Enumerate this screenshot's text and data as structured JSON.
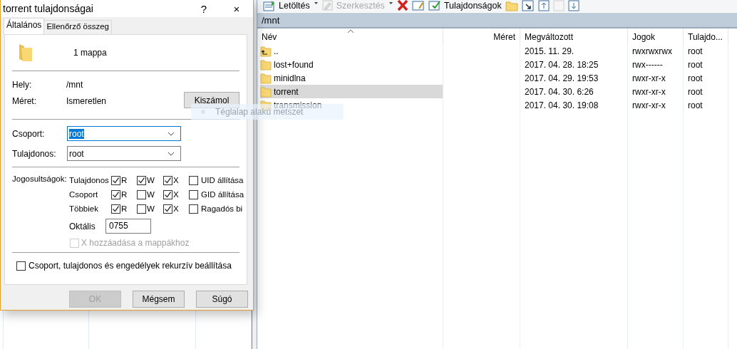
{
  "dialog": {
    "title": "torrent tulajdonságai",
    "help": "?",
    "close": "×",
    "tabs": [
      {
        "label": "Általános",
        "selected": true
      },
      {
        "label": "Ellenőrző összeg",
        "selected": false
      }
    ],
    "summary": "1 mappa",
    "fields": [
      {
        "label": "Hely:",
        "value": "/mnt"
      },
      {
        "label": "Méret:",
        "value": "Ismeretlen"
      }
    ],
    "calc_button": "Kiszámol",
    "group": {
      "label": "Csoport:",
      "value": "root",
      "focused": true
    },
    "owner": {
      "label": "Tulajdonos:",
      "value": "root",
      "focused": false
    },
    "permissions": {
      "label": "Jogosultságok:",
      "rows": [
        {
          "label": "Tulajdonos",
          "checks": [
            {
              "label": "R",
              "checked": true
            },
            {
              "label": "W",
              "checked": true
            },
            {
              "label": "X",
              "checked": true
            }
          ],
          "special": {
            "label": "UID állítása",
            "checked": false
          }
        },
        {
          "label": "Csoport",
          "checks": [
            {
              "label": "R",
              "checked": true
            },
            {
              "label": "W",
              "checked": false
            },
            {
              "label": "X",
              "checked": true
            }
          ],
          "special": {
            "label": "GID állítása",
            "checked": false
          }
        },
        {
          "label": "Többiek",
          "checks": [
            {
              "label": "R",
              "checked": true
            },
            {
              "label": "W",
              "checked": false
            },
            {
              "label": "X",
              "checked": true
            }
          ],
          "special": {
            "label": "Ragadós bi",
            "checked": false
          }
        }
      ]
    },
    "octal": {
      "label": "Oktális",
      "value": "0755"
    },
    "add_x": {
      "label": "X hozzáadása a mappákhoz",
      "checked": false,
      "disabled": true
    },
    "recursive": {
      "label": "Csoport, tulajdonos és engedélyek rekurzív beállítása",
      "checked": false
    },
    "buttons": [
      {
        "label": "OK",
        "disabled": true
      },
      {
        "label": "Mégsem",
        "disabled": false
      },
      {
        "label": "Súgó",
        "disabled": false
      }
    ]
  },
  "toolbar": [
    {
      "kind": "download",
      "label": "Letöltés",
      "disabled": false
    },
    {
      "kind": "caret"
    },
    {
      "kind": "edit",
      "label": "Szerkesztés",
      "disabled": true
    },
    {
      "kind": "caret"
    },
    {
      "kind": "delete"
    },
    {
      "kind": "rename"
    },
    {
      "kind": "properties",
      "label": "Tulajdonságok",
      "disabled": false
    },
    {
      "kind": "folder"
    },
    {
      "kind": "window"
    },
    {
      "kind": "up"
    },
    {
      "kind": "blank"
    },
    {
      "kind": "down"
    }
  ],
  "path": "/mnt",
  "file_list": {
    "columns": [
      {
        "label": "Név"
      },
      {
        "label": "Méret"
      },
      {
        "label": "Megváltozott"
      },
      {
        "label": "Jogok"
      },
      {
        "label": "Tulajdo..."
      }
    ],
    "rows": [
      {
        "kind": "up",
        "name": "..",
        "modified": "2015. 11. 29.",
        "rights": "rwxrwxrwx",
        "owner": "root",
        "selected": false
      },
      {
        "kind": "folder",
        "name": "lost+found",
        "modified": "2017. 04. 28. 18:25",
        "rights": "rwx------",
        "owner": "root",
        "selected": false
      },
      {
        "kind": "folder",
        "name": "minidlna",
        "modified": "2017. 04. 29. 19:53",
        "rights": "rwxr-xr-x",
        "owner": "root",
        "selected": false
      },
      {
        "kind": "folder",
        "name": "torrent",
        "modified": "2017. 04. 30. 6:26",
        "rights": "rwxr-xr-x",
        "owner": "root",
        "selected": true
      },
      {
        "kind": "folder",
        "name": "transmission",
        "modified": "2017. 04. 30. 19:08",
        "rights": "rwxr-xr-x",
        "owner": "root",
        "selected": false
      }
    ]
  },
  "tooltip": "Téglalap alakú metszet"
}
